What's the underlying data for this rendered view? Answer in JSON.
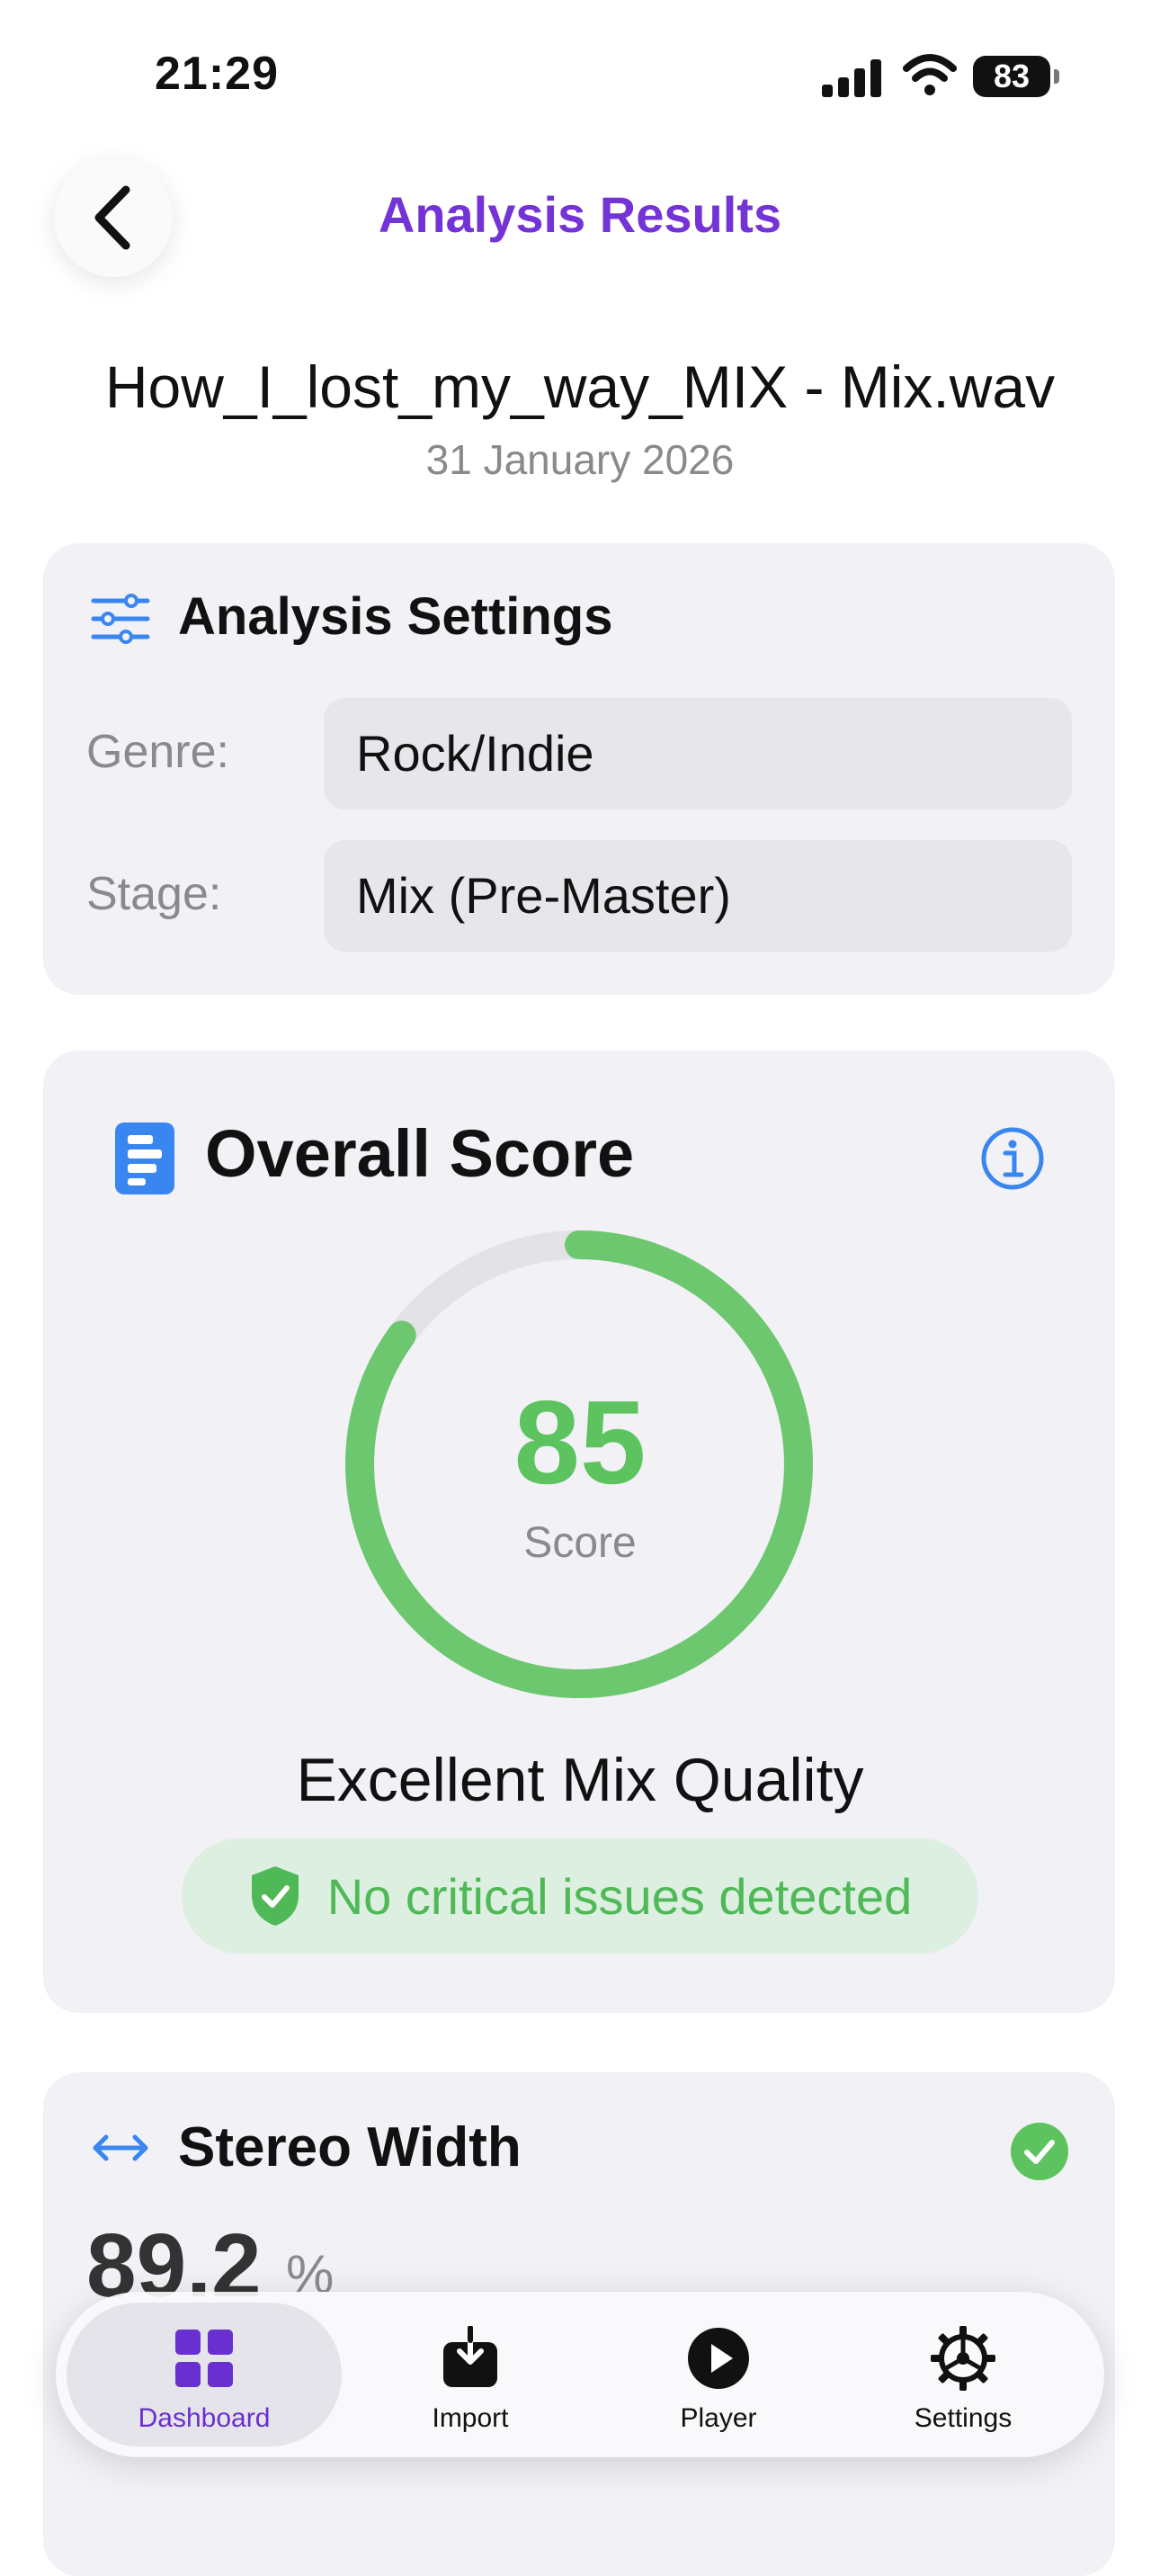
{
  "status_bar": {
    "time": "21:29",
    "battery": "83"
  },
  "header": {
    "title": "Analysis Results"
  },
  "file": {
    "name": "How_I_lost_my_way_MIX - Mix.wav",
    "date": "31 January 2026"
  },
  "analysis_settings": {
    "title": "Analysis Settings",
    "genre_label": "Genre:",
    "genre_value": "Rock/Indie",
    "stage_label": "Stage:",
    "stage_value": "Mix (Pre-Master)"
  },
  "overall_score": {
    "title": "Overall Score",
    "value": "85",
    "score_fraction": 0.85,
    "label": "Score",
    "quality": "Excellent Mix Quality",
    "issues": "No critical issues detected"
  },
  "stereo_width": {
    "title": "Stereo Width",
    "value": "89.2",
    "unit": "%"
  },
  "tabs": [
    {
      "label": "Dashboard",
      "icon": "dashboard-grid-icon",
      "active": true
    },
    {
      "label": "Import",
      "icon": "import-tray-icon",
      "active": false
    },
    {
      "label": "Player",
      "icon": "play-circle-icon",
      "active": false
    },
    {
      "label": "Settings",
      "icon": "gear-icon",
      "active": false
    }
  ],
  "colors": {
    "accent": "#7433d6",
    "score_green": "#5cc35e",
    "info_blue": "#3a86f0"
  }
}
